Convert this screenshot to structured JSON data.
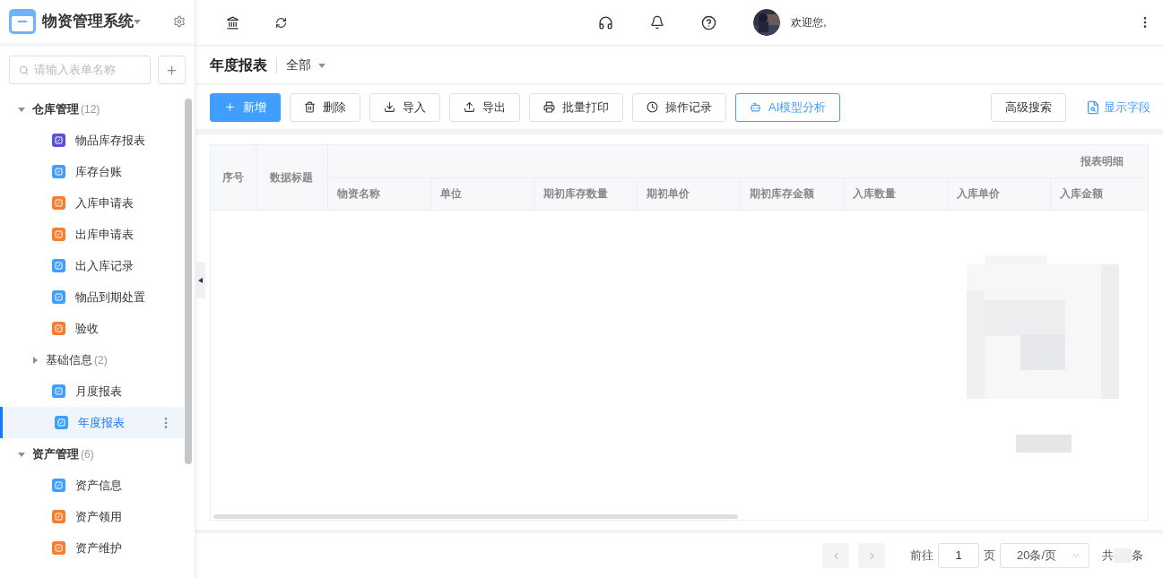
{
  "app": {
    "title": "物资管理系统"
  },
  "sidebar": {
    "search": {
      "placeholder": "请输入表单名称"
    },
    "tree": [
      {
        "kind": "group",
        "label": "仓库管理",
        "count": "(12)",
        "expanded": true,
        "children": [
          {
            "kind": "item",
            "label": "物品库存报表",
            "color": "#5b4fd6",
            "selected": false
          },
          {
            "kind": "item",
            "label": "库存台账",
            "color": "#409eff",
            "selected": false
          },
          {
            "kind": "item",
            "label": "入库申请表",
            "color": "#fa7d2e",
            "selected": false
          },
          {
            "kind": "item",
            "label": "出库申请表",
            "color": "#fa7d2e",
            "selected": false
          },
          {
            "kind": "item",
            "label": "出入库记录",
            "color": "#409eff",
            "selected": false
          },
          {
            "kind": "item",
            "label": "物品到期处置",
            "color": "#409eff",
            "selected": false
          },
          {
            "kind": "item",
            "label": "验收",
            "color": "#fa7d2e",
            "selected": false
          },
          {
            "kind": "group",
            "label": "基础信息",
            "count": "(2)",
            "expanded": false
          },
          {
            "kind": "item",
            "label": "月度报表",
            "color": "#409eff",
            "selected": false
          },
          {
            "kind": "item",
            "label": "年度报表",
            "color": "#409eff",
            "selected": true
          }
        ]
      },
      {
        "kind": "group",
        "label": "资产管理",
        "count": "(6)",
        "expanded": true,
        "children": [
          {
            "kind": "item",
            "label": "资产信息",
            "color": "#409eff",
            "selected": false
          },
          {
            "kind": "item",
            "label": "资产领用",
            "color": "#fa7d2e",
            "selected": false
          },
          {
            "kind": "item",
            "label": "资产维护",
            "color": "#fa7d2e",
            "selected": false
          }
        ]
      }
    ]
  },
  "header": {
    "greeting": "欢迎您,"
  },
  "page": {
    "title": "年度报表",
    "filter": "全部"
  },
  "toolbar": [
    {
      "kind": "primary",
      "label": "新增"
    },
    {
      "kind": "default",
      "label": "删除"
    },
    {
      "kind": "default",
      "label": "导入"
    },
    {
      "kind": "default",
      "label": "导出"
    },
    {
      "kind": "default",
      "label": "批量打印"
    },
    {
      "kind": "default",
      "label": "操作记录"
    },
    {
      "kind": "outline",
      "label": "AI模型分析"
    }
  ],
  "toolbar_right": {
    "search_button": "高级搜索",
    "fields_link": "显示字段"
  },
  "table": {
    "fixed_columns": [
      "序号",
      "数据标题"
    ],
    "group_header": "报表明细",
    "columns": [
      "物资名称",
      "单位",
      "期初库存数量",
      "期初单价",
      "期初库存金额",
      "入库数量",
      "入库单价",
      "入库金额"
    ]
  },
  "pagination": {
    "goto_label": "前往",
    "page": "1",
    "page_unit": "页",
    "page_size": "20条/页",
    "total_prefix": "共",
    "total_suffix": "条"
  }
}
